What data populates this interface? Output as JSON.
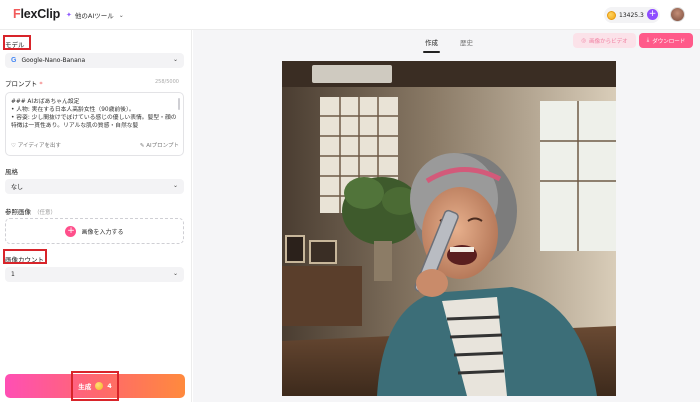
{
  "header": {
    "logo_prefix": "F",
    "logo_rest": "lexClip",
    "tools_label": "他のAIツール",
    "credits": "13425.3",
    "plus": "+"
  },
  "left_panel": {
    "model_label": "モデル",
    "model_value": "Google-Nano-Banana",
    "model_icon": "G",
    "prompt_label": "プロンプト",
    "prompt_required": "*",
    "prompt_count": "258/5000",
    "prompt_text": "### AIおばあちゃん設定\n• 人物: 実在する日本人高齢女性（90歳前後）。\n• 容姿: 少し間抜けでぼけている感じの優しい表情。髪型・顔の特徴は一貫性あり。リアルな肌の質感・自然な髪",
    "idea_button": "アイディアを出す",
    "ai_prompt_button": "AIプロンプト",
    "style_label": "風格",
    "style_value": "なし",
    "ref_image_label": "参照画像",
    "ref_image_optional": "（任意）",
    "upload_label": "画像を入力する",
    "image_count_label": "画像カウント",
    "image_count_value": "1",
    "generate_label": "生成",
    "generate_cost": "4"
  },
  "main": {
    "tab_create": "作成",
    "tab_history": "歴史",
    "to_video_label": "画像からビデオ",
    "download_label": "ダウンロード"
  },
  "colors": {
    "accent_pink": "#ff5a8a",
    "highlight_red": "#d8242a",
    "brand_purple": "#8e4dff"
  }
}
